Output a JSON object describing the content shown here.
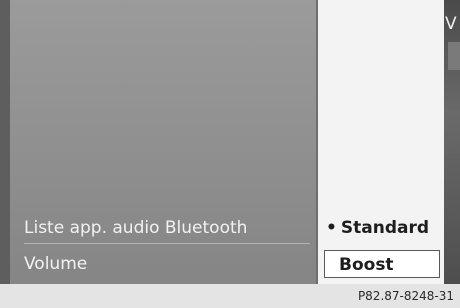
{
  "menu": {
    "items": [
      {
        "label": "Liste app. audio Bluetooth"
      },
      {
        "label": "Volume"
      }
    ]
  },
  "popup": {
    "options": [
      {
        "label": "Standard",
        "selected": true
      },
      {
        "label": "Boost",
        "selected": false
      }
    ]
  },
  "edge_letter": "V",
  "caption": "P82.87-8248-31"
}
